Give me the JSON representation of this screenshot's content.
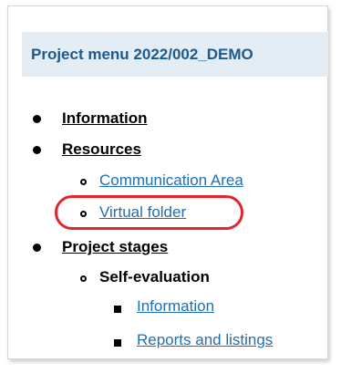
{
  "menu": {
    "title": "Project menu 2022/002_DEMO",
    "items": [
      {
        "label": "Information"
      },
      {
        "label": "Resources",
        "children": [
          {
            "label": "Communication Area"
          },
          {
            "label": "Virtual folder"
          }
        ]
      },
      {
        "label": "Project stages",
        "children": [
          {
            "label": "Self-evaluation",
            "children": [
              {
                "label": "Information"
              },
              {
                "label": "Reports and listings"
              }
            ]
          }
        ]
      }
    ]
  },
  "colors": {
    "header_bg": "#e4ecf4",
    "header_text": "#1d5a8e",
    "link": "#1f6fb5",
    "highlight": "#e3242b"
  },
  "icons": {
    "level1_bullet": "disc",
    "level2_bullet": "circle",
    "level3_bullet": "square"
  }
}
